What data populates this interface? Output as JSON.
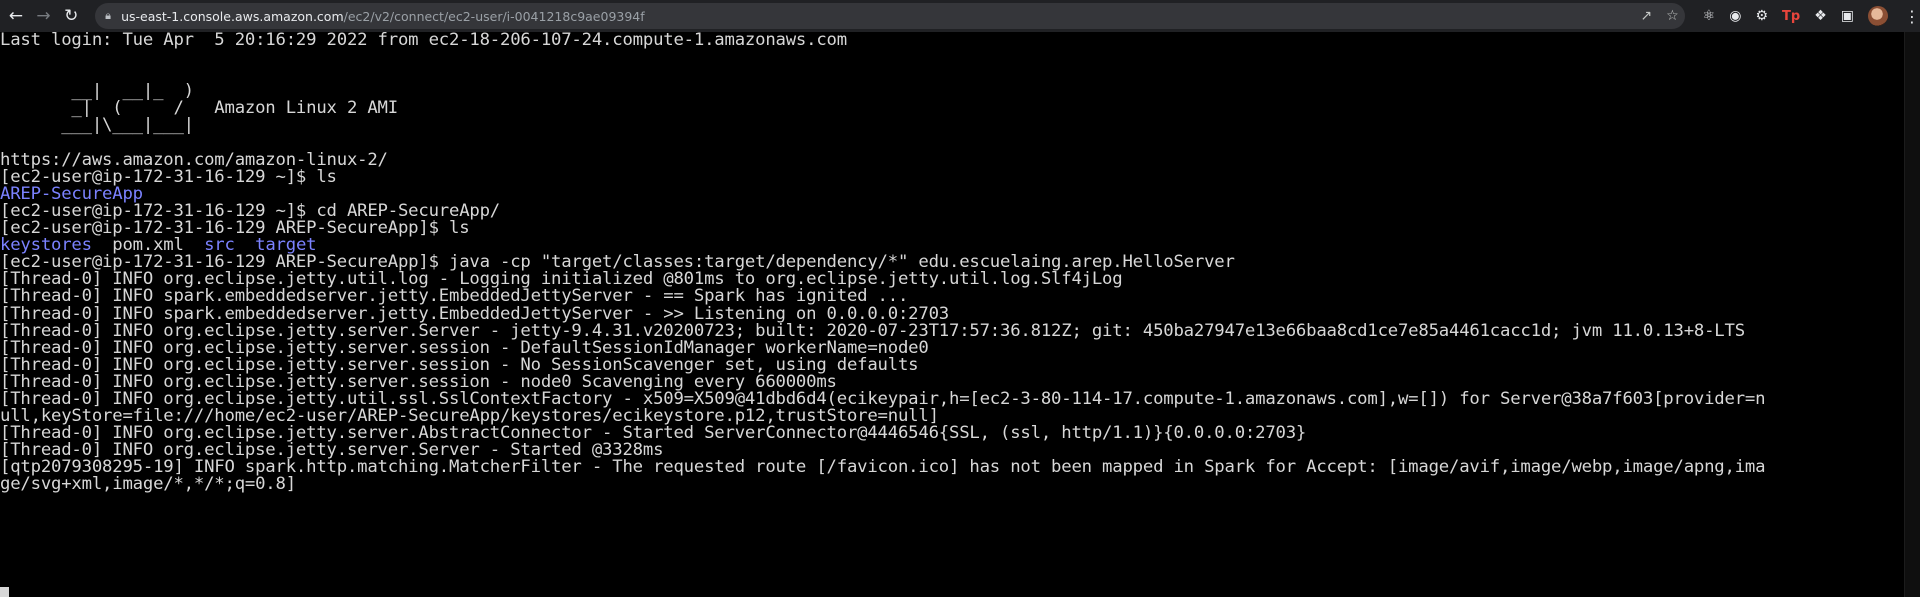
{
  "browser": {
    "url_host": "us-east-1.console.aws.amazon.com",
    "url_path": "/ec2/v2/connect/ec2-user/i-0041218c9ae09394f",
    "icons": [
      "back-icon",
      "forward-icon",
      "reload-icon",
      "lock-icon",
      "share-icon",
      "bookmark-star-icon",
      "react-extension-icon",
      "record-extension-icon",
      "settings-extension-icon",
      "tp-extension-icon",
      "puzzle-extensions-icon",
      "sidebar-icon",
      "profile-avatar",
      "menu-icon"
    ]
  },
  "terminal": {
    "lines": [
      {
        "text": "Last login: Tue Apr  5 20:16:29 2022 from ec2-18-206-107-24.compute-1.amazonaws.com"
      },
      {
        "text": ""
      },
      {
        "text": ""
      },
      {
        "text": "       __|  __|_  )"
      },
      {
        "text": "       _|  (     /   Amazon Linux 2 AMI"
      },
      {
        "text": "      ___|\\___|___|"
      },
      {
        "text": ""
      },
      {
        "text": "https://aws.amazon.com/amazon-linux-2/"
      },
      {
        "text": "[ec2-user@ip-172-31-16-129 ~]$ ls"
      },
      {
        "text": "AREP-SecureApp",
        "segments": [
          {
            "t": "AREP-SecureApp",
            "c": "blue"
          }
        ]
      },
      {
        "text": "[ec2-user@ip-172-31-16-129 ~]$ cd AREP-SecureApp/"
      },
      {
        "text": "[ec2-user@ip-172-31-16-129 AREP-SecureApp]$ ls"
      },
      {
        "text": "keystores  pom.xml  src  target",
        "segments": [
          {
            "t": "keystores",
            "c": "blue"
          },
          {
            "t": "  pom.xml  ",
            "c": ""
          },
          {
            "t": "src",
            "c": "blue"
          },
          {
            "t": "  ",
            "c": ""
          },
          {
            "t": "target",
            "c": "blue"
          }
        ]
      },
      {
        "text": "[ec2-user@ip-172-31-16-129 AREP-SecureApp]$ java -cp \"target/classes:target/dependency/*\" edu.escuelaing.arep.HelloServer"
      },
      {
        "text": "[Thread-0] INFO org.eclipse.jetty.util.log - Logging initialized @801ms to org.eclipse.jetty.util.log.Slf4jLog"
      },
      {
        "text": "[Thread-0] INFO spark.embeddedserver.jetty.EmbeddedJettyServer - == Spark has ignited ..."
      },
      {
        "text": "[Thread-0] INFO spark.embeddedserver.jetty.EmbeddedJettyServer - >> Listening on 0.0.0.0:2703"
      },
      {
        "text": "[Thread-0] INFO org.eclipse.jetty.server.Server - jetty-9.4.31.v20200723; built: 2020-07-23T17:57:36.812Z; git: 450ba27947e13e66baa8cd1ce7e85a4461cacc1d; jvm 11.0.13+8-LTS"
      },
      {
        "text": "[Thread-0] INFO org.eclipse.jetty.server.session - DefaultSessionIdManager workerName=node0"
      },
      {
        "text": "[Thread-0] INFO org.eclipse.jetty.server.session - No SessionScavenger set, using defaults"
      },
      {
        "text": "[Thread-0] INFO org.eclipse.jetty.server.session - node0 Scavenging every 660000ms"
      },
      {
        "text": "[Thread-0] INFO org.eclipse.jetty.util.ssl.SslContextFactory - x509=X509@41dbd6d4(ecikeypair,h=[ec2-3-80-114-17.compute-1.amazonaws.com],w=[]) for Server@38a7f603[provider=n"
      },
      {
        "text": "ull,keyStore=file:///home/ec2-user/AREP-SecureApp/keystores/ecikeystore.p12,trustStore=null]"
      },
      {
        "text": "[Thread-0] INFO org.eclipse.jetty.server.AbstractConnector - Started ServerConnector@4446546{SSL, (ssl, http/1.1)}{0.0.0.0:2703}"
      },
      {
        "text": "[Thread-0] INFO org.eclipse.jetty.server.Server - Started @3328ms"
      },
      {
        "text": "[qtp2079308295-19] INFO spark.http.matching.MatcherFilter - The requested route [/favicon.ico] has not been mapped in Spark for Accept: [image/avif,image/webp,image/apng,ima"
      },
      {
        "text": "ge/svg+xml,image/*,*/*;q=0.8]"
      }
    ]
  }
}
